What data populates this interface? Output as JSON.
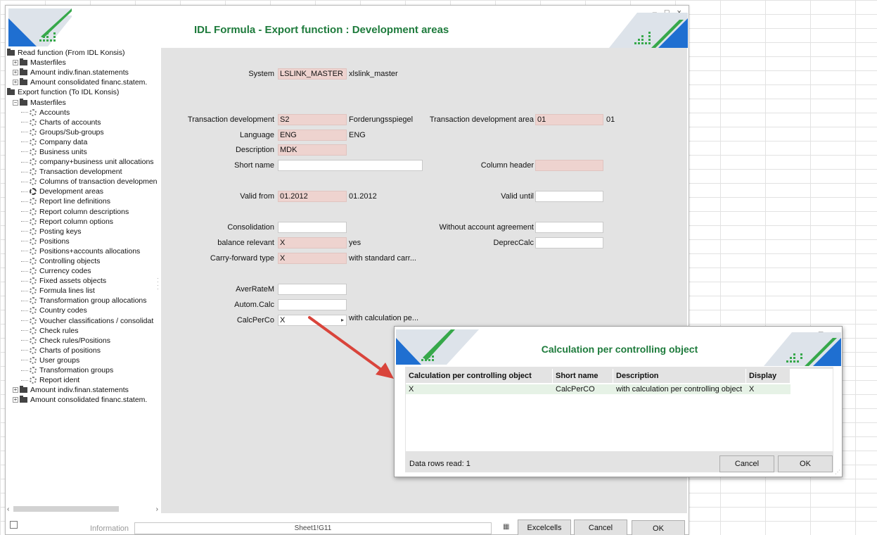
{
  "window": {
    "title": "IDL Formula  - Export function : Development areas",
    "controls": "– □ ×"
  },
  "tree": {
    "items": [
      {
        "label": "Read function (From IDL Konsis)",
        "level": 0,
        "type": "folder"
      },
      {
        "label": "Masterfiles",
        "level": 1,
        "type": "folder",
        "exp": "+"
      },
      {
        "label": "Amount indiv.finan.statements",
        "level": 1,
        "type": "folder",
        "exp": "+"
      },
      {
        "label": "Amount consolidated financ.statem.",
        "level": 1,
        "type": "folder",
        "exp": "+"
      },
      {
        "label": "Export function (To IDL Konsis)",
        "level": 0,
        "type": "folder"
      },
      {
        "label": "Masterfiles",
        "level": 1,
        "type": "folder",
        "exp": "−"
      },
      {
        "label": "Accounts",
        "level": 2,
        "type": "gear"
      },
      {
        "label": "Charts of accounts",
        "level": 2,
        "type": "gear"
      },
      {
        "label": "Groups/Sub-groups",
        "level": 2,
        "type": "gear"
      },
      {
        "label": "Company data",
        "level": 2,
        "type": "gear"
      },
      {
        "label": "Business units",
        "level": 2,
        "type": "gear"
      },
      {
        "label": "company+business unit allocations",
        "level": 2,
        "type": "gear"
      },
      {
        "label": "Transaction development",
        "level": 2,
        "type": "gear"
      },
      {
        "label": "Columns of transaction developmen",
        "level": 2,
        "type": "gear"
      },
      {
        "label": "Development areas",
        "level": 2,
        "type": "gear",
        "active": true
      },
      {
        "label": "Report line definitions",
        "level": 2,
        "type": "gear"
      },
      {
        "label": "Report column descriptions",
        "level": 2,
        "type": "gear"
      },
      {
        "label": "Report column options",
        "level": 2,
        "type": "gear"
      },
      {
        "label": "Posting keys",
        "level": 2,
        "type": "gear"
      },
      {
        "label": "Positions",
        "level": 2,
        "type": "gear"
      },
      {
        "label": "Positions+accounts allocations",
        "level": 2,
        "type": "gear"
      },
      {
        "label": "Controlling objects",
        "level": 2,
        "type": "gear"
      },
      {
        "label": "Currency codes",
        "level": 2,
        "type": "gear"
      },
      {
        "label": "Fixed assets objects",
        "level": 2,
        "type": "gear"
      },
      {
        "label": "Formula lines list",
        "level": 2,
        "type": "gear"
      },
      {
        "label": "Transformation group allocations",
        "level": 2,
        "type": "gear"
      },
      {
        "label": "Country codes",
        "level": 2,
        "type": "gear"
      },
      {
        "label": "Voucher classifications / consolidat",
        "level": 2,
        "type": "gear"
      },
      {
        "label": "Check rules",
        "level": 2,
        "type": "gear"
      },
      {
        "label": "Check rules/Positions",
        "level": 2,
        "type": "gear"
      },
      {
        "label": "Charts of positions",
        "level": 2,
        "type": "gear"
      },
      {
        "label": "User groups",
        "level": 2,
        "type": "gear"
      },
      {
        "label": "Transformation groups",
        "level": 2,
        "type": "gear"
      },
      {
        "label": "Report ident",
        "level": 2,
        "type": "gear"
      },
      {
        "label": "Amount indiv.finan.statements",
        "level": 1,
        "type": "folder",
        "exp": "+"
      },
      {
        "label": "Amount consolidated financ.statem.",
        "level": 1,
        "type": "folder",
        "exp": "+"
      }
    ],
    "scroll_left": "‹",
    "scroll_right": "›"
  },
  "form": {
    "system_label": "System",
    "system_value": "LSLINK_MASTER",
    "system_desc": "xlslink_master",
    "transdev_label": "Transaction development",
    "transdev_value": "S2",
    "transdev_desc": "Forderungsspiegel",
    "transdev_area_label": "Transaction development area",
    "transdev_area_value": "01",
    "transdev_area_desc": "01",
    "language_label": "Language",
    "language_value": "ENG",
    "language_desc": "ENG",
    "description_label": "Description",
    "description_value": "MDK",
    "shortname_label": "Short name",
    "shortname_value": "",
    "colheader_label": "Column header",
    "colheader_value": "",
    "validfrom_label": "Valid from",
    "validfrom_value": "01.2012",
    "validfrom_desc": "01.2012",
    "validuntil_label": "Valid until",
    "validuntil_value": "",
    "consolidation_label": "Consolidation",
    "consolidation_value": "",
    "without_acct_label": "Without account agreement",
    "without_acct_value": "",
    "balance_label": "balance relevant",
    "balance_value": "X",
    "balance_desc": "yes",
    "depreccalc_label": "DeprecCalc",
    "depreccalc_value": "",
    "carry_label": "Carry-forward type",
    "carry_value": "X",
    "carry_desc": "with standard carr...",
    "averratem_label": "AverRateM",
    "averratem_value": "",
    "automcalc_label": "Autom.Calc",
    "automcalc_value": "",
    "calcperco_label": "CalcPerCo",
    "calcperco_value": "X",
    "calcperco_desc": "with calculation pe...",
    "combo_arrow": "▸"
  },
  "status": {
    "info_label": "Information",
    "info_value": "Sheet1!G11",
    "excel_icon": "▦",
    "excelcells_label": "Excelcells",
    "cancel_label": "Cancel",
    "ok_label": "OK"
  },
  "dialog": {
    "title": "Calculation per controlling object",
    "controls": "– □ ×",
    "columns": [
      "Calculation per controlling object",
      "Short name",
      "Description",
      "Display"
    ],
    "rows": [
      [
        "X",
        "CalcPerCO",
        "with calculation per controlling object",
        "X"
      ]
    ],
    "rows_read": "Data rows read: 1",
    "cancel_label": "Cancel",
    "ok_label": "OK"
  },
  "colors": {
    "title_green": "#1e7b3c",
    "field_pink": "#eed3cf",
    "panel_gray": "#e3e3e3",
    "arrow_red": "#d9443b",
    "logo_blue": "#1f6fd1",
    "logo_green": "#36a84a"
  }
}
